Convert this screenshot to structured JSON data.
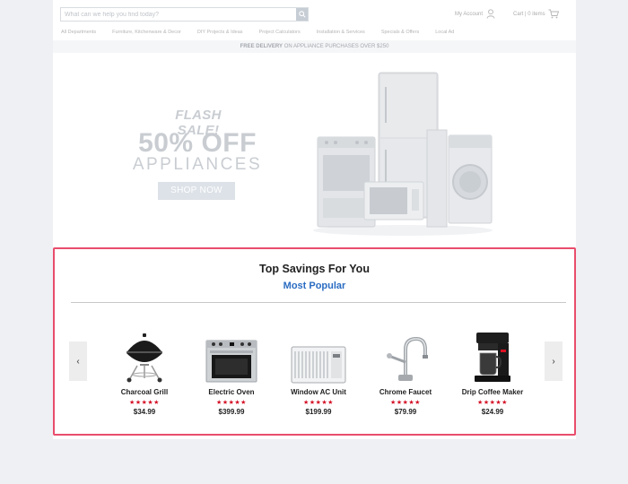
{
  "header": {
    "search_placeholder": "What can we help you find today?",
    "account_label": "My Account",
    "cart_label": "Cart | 0 items",
    "nav": [
      "All Departments",
      "Furniture, Kitchenware & Decor",
      "DIY Projects & Ideas",
      "Project Calculators",
      "Installation & Services",
      "Specials & Offers",
      "Local Ad"
    ]
  },
  "promo": {
    "bold": "FREE DELIVERY",
    "rest": " ON APPLIANCE PURCHASES OVER $250"
  },
  "hero": {
    "flash": "FLASH SALE!",
    "headline": "50% OFF",
    "subline": "APPLIANCES",
    "cta": "SHOP NOW"
  },
  "panel": {
    "title": "Top Savings For You",
    "subtitle": "Most Popular",
    "prev": "‹",
    "next": "›",
    "products": [
      {
        "name": "Charcoal Grill",
        "price": "$34.99",
        "icon": "charcoal-grill-icon",
        "rating": 4.5
      },
      {
        "name": "Electric Oven",
        "price": "$399.99",
        "icon": "electric-oven-icon",
        "rating": 4.5
      },
      {
        "name": "Window AC Unit",
        "price": "$199.99",
        "icon": "window-ac-icon",
        "rating": 4.5
      },
      {
        "name": "Chrome Faucet",
        "price": "$79.99",
        "icon": "chrome-faucet-icon",
        "rating": 4.5
      },
      {
        "name": "Drip Coffee Maker",
        "price": "$24.99",
        "icon": "coffee-maker-icon",
        "rating": 4.5
      }
    ],
    "stars_text": "★★★★★"
  },
  "colors": {
    "accent": "#e94d6c",
    "link": "#2b6cc2",
    "star": "#d40f25"
  }
}
